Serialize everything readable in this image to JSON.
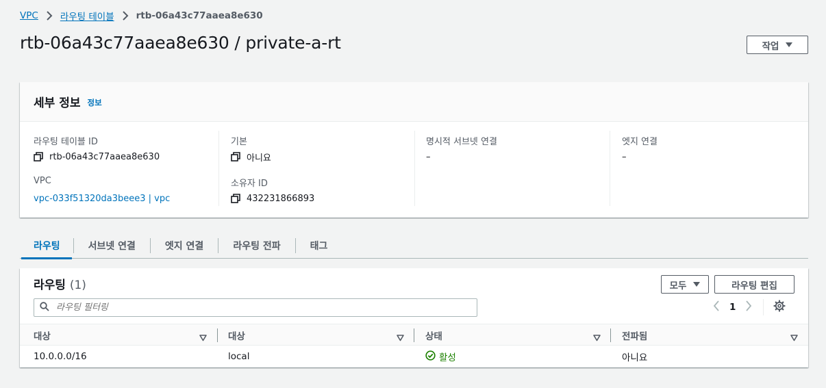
{
  "breadcrumb": {
    "items": [
      "VPC",
      "라우팅 테이블"
    ],
    "current": "rtb-06a43c77aaea8e630"
  },
  "header": {
    "title": "rtb-06a43c77aaea8e630 / private-a-rt",
    "actions_label": "작업"
  },
  "details": {
    "title": "세부 정보",
    "info_label": "정보",
    "fields": {
      "route_table_id": {
        "label": "라우팅 테이블 ID",
        "value": "rtb-06a43c77aaea8e630"
      },
      "vpc": {
        "label": "VPC",
        "value": "vpc-033f51320da3beee3 | vpc"
      },
      "main": {
        "label": "기본",
        "value": "아니요"
      },
      "owner_id": {
        "label": "소유자 ID",
        "value": "432231866893"
      },
      "explicit_subnet": {
        "label": "명시적 서브넷 연결",
        "value": "–"
      },
      "edge": {
        "label": "엣지 연결",
        "value": "–"
      }
    }
  },
  "tabs": [
    {
      "label": "라우팅",
      "active": true
    },
    {
      "label": "서브넷 연결",
      "active": false
    },
    {
      "label": "엣지 연결",
      "active": false
    },
    {
      "label": "라우팅 전파",
      "active": false
    },
    {
      "label": "태그",
      "active": false
    }
  ],
  "routes": {
    "title": "라우팅",
    "count": "(1)",
    "filter_label": "모두",
    "edit_label": "라우팅 편집",
    "search_placeholder": "라우팅 필터링",
    "page": "1",
    "columns": [
      "대상",
      "대상",
      "상태",
      "전파됨"
    ],
    "rows": [
      {
        "destination": "10.0.0.0/16",
        "target": "local",
        "status": "활성",
        "propagated": "아니요"
      }
    ]
  },
  "colors": {
    "link": "#0073bb",
    "status_ok": "#1d8102",
    "text": "#16191f",
    "muted": "#545b64"
  },
  "icons": [
    "chevron-right-icon",
    "caret-down-icon",
    "copy-icon",
    "search-icon",
    "chevron-left-icon",
    "settings-icon",
    "sort-icon",
    "status-success-icon"
  ]
}
